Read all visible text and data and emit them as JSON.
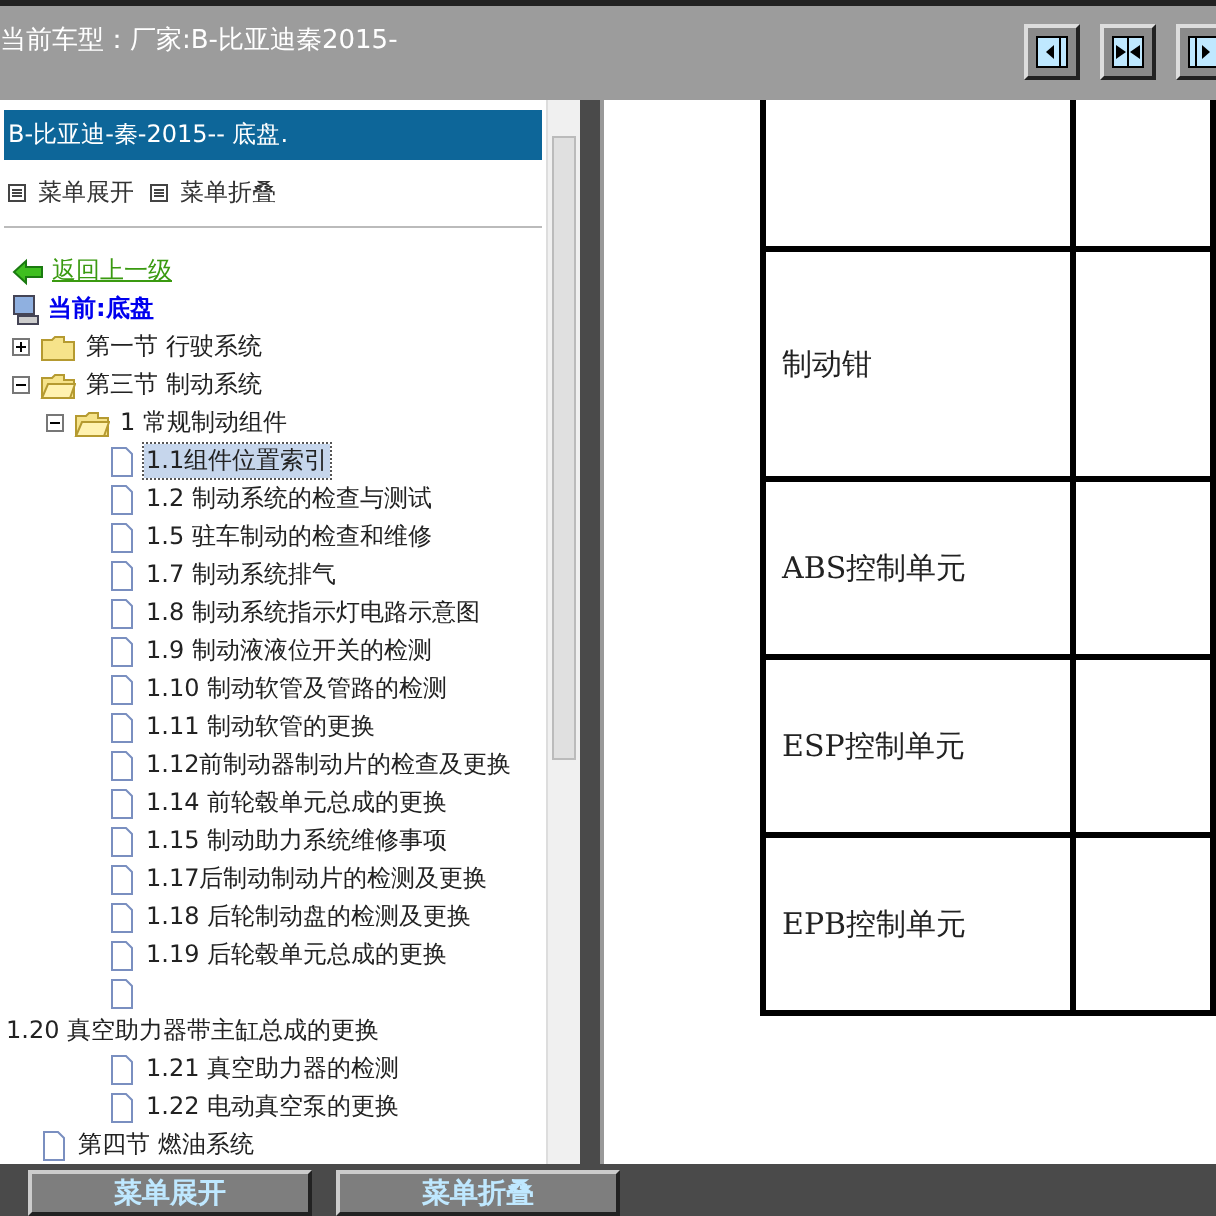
{
  "top_bar": {
    "title": "当前车型：厂家:B-比亚迪秦2015-"
  },
  "toolbar": [
    {
      "kind": "right"
    },
    {
      "kind": "center"
    },
    {
      "kind": "left"
    }
  ],
  "sidebar": {
    "header": "B-比亚迪-秦-2015-- 底盘.",
    "menu": [
      "菜单展开",
      "菜单折叠"
    ],
    "tree": [
      {
        "kind": "link",
        "label": "返回上一级"
      },
      {
        "kind": "current",
        "label": "当前:底盘"
      },
      {
        "kind": "folder",
        "label": "第一节 行驶系统",
        "expanded": false
      },
      {
        "kind": "folder",
        "label": "第三节 制动系统",
        "expanded": true,
        "children": [
          {
            "kind": "folder",
            "label": "1 常规制动组件",
            "expanded": true,
            "children": [
              {
                "kind": "page",
                "label": "1.1组件位置索引",
                "selected": true
              },
              {
                "kind": "page",
                "label": "1.2 制动系统的检查与测试",
                "selected": false
              },
              {
                "kind": "page",
                "label": "1.5 驻车制动的检查和维修",
                "selected": false
              },
              {
                "kind": "page",
                "label": "1.7 制动系统排气",
                "selected": false
              },
              {
                "kind": "page",
                "label": "1.8 制动系统指示灯电路示意图",
                "selected": false
              },
              {
                "kind": "page",
                "label": "1.9 制动液液位开关的检测",
                "selected": false
              },
              {
                "kind": "page",
                "label": "1.10 制动软管及管路的检测",
                "selected": false
              },
              {
                "kind": "page",
                "label": "1.11 制动软管的更换",
                "selected": false
              },
              {
                "kind": "page",
                "label": "1.12前制动器制动片的检查及更换",
                "selected": false
              },
              {
                "kind": "page",
                "label": "1.14 前轮毂单元总成的更换",
                "selected": false
              },
              {
                "kind": "page",
                "label": "1.15 制动助力系统维修事项",
                "selected": false
              },
              {
                "kind": "page",
                "label": "1.17后制动制动片的检测及更换",
                "selected": false
              },
              {
                "kind": "page",
                "label": "1.18 后轮制动盘的检测及更换",
                "selected": false
              },
              {
                "kind": "page",
                "label": "1.19 后轮毂单元总成的更换",
                "selected": false
              },
              {
                "kind": "page",
                "selected": false
              },
              {
                "kind": "wrapped",
                "label": "1.20 真空助力器带主缸总成的更换"
              },
              {
                "kind": "page",
                "label": "1.21 真空助力器的检测",
                "selected": false
              },
              {
                "kind": "page",
                "label": "1.22 电动真空泵的更换",
                "selected": false
              }
            ]
          }
        ]
      },
      {
        "kind": "page",
        "label": "第四节 燃油系统",
        "selected": false
      }
    ]
  },
  "table": {
    "rows": [
      {},
      {
        "column_1": "制动钳"
      },
      {
        "column_1": "ABS控制单元"
      },
      {
        "column_1": "ESP控制单元"
      },
      {
        "column_1": "EPB控制单元"
      }
    ]
  },
  "bottom_buttons": [
    "菜单展开",
    "菜单折叠"
  ]
}
